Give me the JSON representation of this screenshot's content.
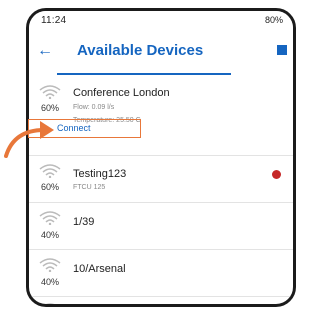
{
  "status_bar": {
    "time": "11:24",
    "battery": "80%"
  },
  "appbar": {
    "title": "Available Devices"
  },
  "devices": [
    {
      "signal": "60%",
      "name": "Conference London",
      "flow": "Flow: 0.09 l/s",
      "temperature": "Temperature: 25.50 C",
      "action": "Connect"
    },
    {
      "signal": "60%",
      "name": "Testing123",
      "model": "FTCU 125",
      "status_color": "#c62828"
    },
    {
      "signal": "40%",
      "name": "1/39"
    },
    {
      "signal": "40%",
      "name": "10/Arsenal"
    }
  ],
  "colors": {
    "accent": "#1565c0",
    "highlight": "#e8773a"
  }
}
